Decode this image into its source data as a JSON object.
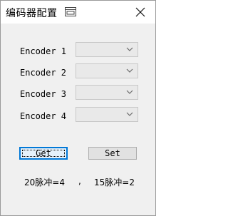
{
  "window": {
    "title": "编码器配置"
  },
  "encoders": [
    {
      "label": "Encoder 1",
      "value": ""
    },
    {
      "label": "Encoder 2",
      "value": ""
    },
    {
      "label": "Encoder 3",
      "value": ""
    },
    {
      "label": "Encoder 4",
      "value": ""
    }
  ],
  "buttons": {
    "get_label": "Get",
    "set_label": "Set"
  },
  "status": {
    "left": "20脉冲=4",
    "separator": ",",
    "right": "15脉冲=2"
  },
  "colors": {
    "focus_border": "#0078d7",
    "window_bg": "#f0f0f0",
    "combo_bg": "#e9e9e9"
  },
  "icons": [
    "window-app-icon",
    "close-icon",
    "chevron-down-icon"
  ]
}
